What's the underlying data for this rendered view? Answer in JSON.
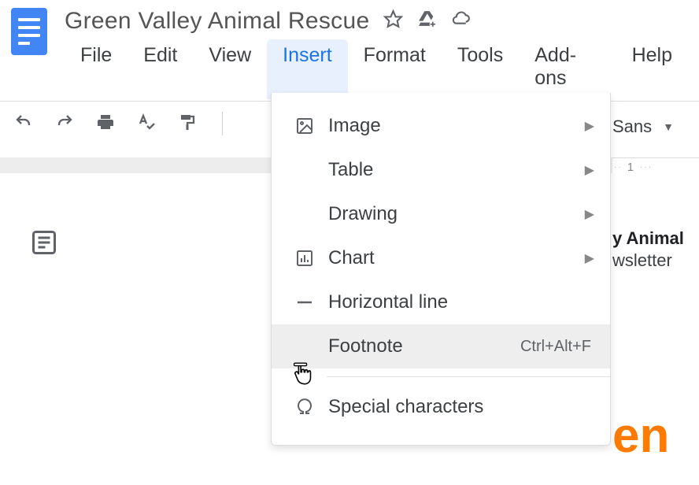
{
  "doc": {
    "title": "Green Valley Animal Rescue",
    "peek_bold": "y Animal",
    "peek_line": "wsletter",
    "orange_fragment": "en"
  },
  "menubar": {
    "items": [
      "File",
      "Edit",
      "View",
      "Insert",
      "Format",
      "Tools",
      "Add-ons",
      "Help"
    ],
    "open_index": 3
  },
  "toolbar": {
    "font": "Sans"
  },
  "ruler": {
    "num": "1"
  },
  "insert_menu": {
    "items": [
      {
        "label": "Image",
        "icon": "image",
        "submenu": true
      },
      {
        "label": "Table",
        "icon": "",
        "submenu": true
      },
      {
        "label": "Drawing",
        "icon": "",
        "submenu": true
      },
      {
        "label": "Chart",
        "icon": "chart",
        "submenu": true
      },
      {
        "label": "Horizontal line",
        "icon": "hline",
        "submenu": false
      },
      {
        "label": "Footnote",
        "icon": "pointer",
        "submenu": false,
        "shortcut": "Ctrl+Alt+F",
        "hovered": true
      },
      {
        "divider": true
      },
      {
        "label": "Special characters",
        "icon": "omega",
        "submenu": false
      }
    ]
  }
}
